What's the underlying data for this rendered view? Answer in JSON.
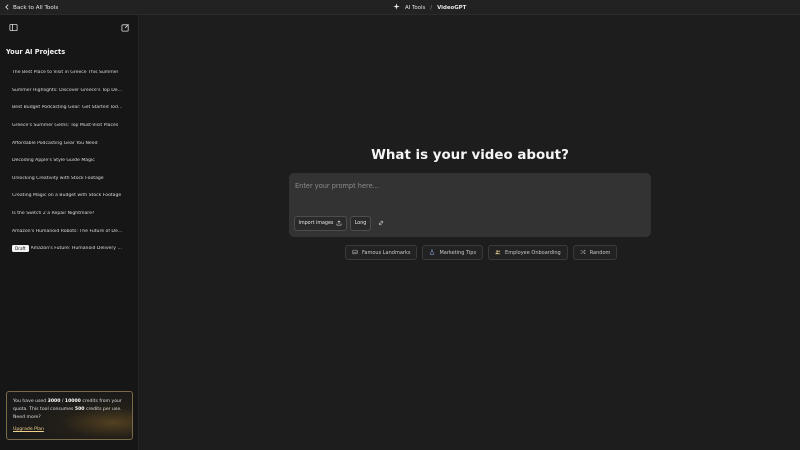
{
  "topbar": {
    "back_label": "Back to All Tools",
    "breadcrumb_tools": "AI Tools",
    "breadcrumb_sep": "/",
    "breadcrumb_current": "VideoGPT"
  },
  "sidebar": {
    "title": "Your AI Projects",
    "projects": [
      {
        "label": "The Best Place to Visit in Greece This Summer"
      },
      {
        "label": "Summer Highlights: Discover Greece's Top Destinations"
      },
      {
        "label": "Best Budget Podcasting Gear: Get Started Today"
      },
      {
        "label": "Greece's Summer Gems: Top Must-Visit Places"
      },
      {
        "label": "Affordable Podcasting Gear You Need"
      },
      {
        "label": "Decoding Apple's Style Guide Magic"
      },
      {
        "label": "Unlocking Creativity with Stock Footage"
      },
      {
        "label": "Creating Magic on a Budget with Stock Footage"
      },
      {
        "label": "Is the Switch 2 a Repair Nightmare?"
      },
      {
        "label": "Amazon's Humanoid Robots: The Future of Delivery"
      },
      {
        "label": "Amazon's Future: Humanoid Delivery Robots",
        "badge": "Draft"
      }
    ]
  },
  "credits": {
    "text_1": "You have used ",
    "used": "3000",
    "text_2": " / ",
    "total": "10000",
    "text_3": " credits from your quota. This tool consumes ",
    "cost": "500",
    "text_4": " credits per use. Need more?",
    "upgrade_label": "Upgrade Plan"
  },
  "main": {
    "title": "What is your video about?",
    "prompt_placeholder": "Enter your prompt here...",
    "import_label": "Import images",
    "length_label": "Long",
    "suggestions": [
      {
        "label": "Famous Landmarks",
        "icon": "image-icon"
      },
      {
        "label": "Marketing Tips",
        "icon": "flask-icon"
      },
      {
        "label": "Employee Onboarding",
        "icon": "people-icon"
      },
      {
        "label": "Random",
        "icon": "shuffle-icon"
      }
    ]
  },
  "colors": {
    "background": "#1d1d1d",
    "sidebar": "#161616",
    "prompt_box": "#333333",
    "accent_gold": "#f2d28a"
  }
}
